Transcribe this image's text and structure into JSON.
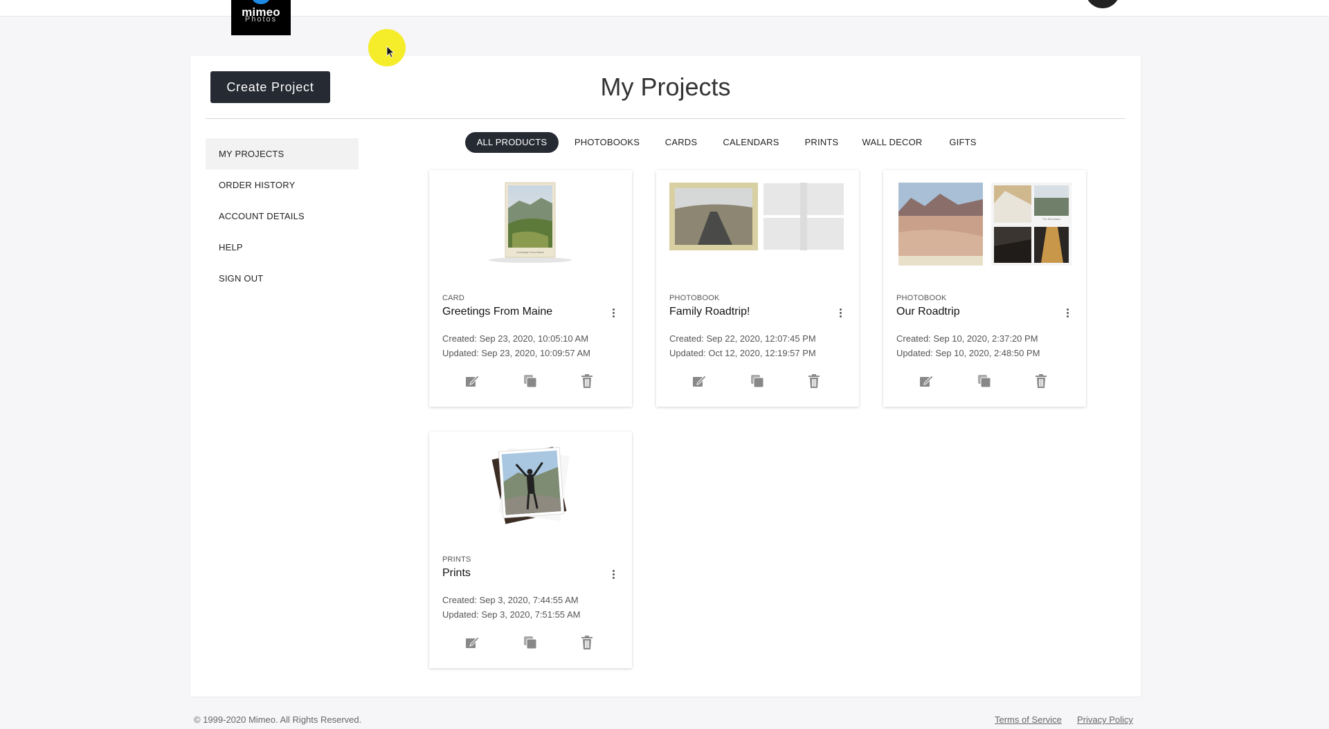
{
  "header": {
    "logo_text": "mimeo",
    "logo_subtext": "Photos"
  },
  "main": {
    "create_button_label": "Create Project",
    "page_title": "My Projects"
  },
  "sidebar": {
    "items": [
      {
        "label": "MY PROJECTS",
        "active": true
      },
      {
        "label": "ORDER HISTORY",
        "active": false
      },
      {
        "label": "ACCOUNT DETAILS",
        "active": false
      },
      {
        "label": "HELP",
        "active": false
      },
      {
        "label": "SIGN OUT",
        "active": false
      }
    ]
  },
  "tabs": [
    {
      "label": "ALL PRODUCTS",
      "active": true
    },
    {
      "label": "PHOTOBOOKS",
      "active": false
    },
    {
      "label": "CARDS",
      "active": false
    },
    {
      "label": "CALENDARS",
      "active": false
    },
    {
      "label": "PRINTS",
      "active": false
    },
    {
      "label": "WALL DECOR",
      "active": false
    },
    {
      "label": "GIFTS",
      "active": false
    }
  ],
  "projects": [
    {
      "type": "CARD",
      "title": "Greetings From Maine",
      "created": "Created: Sep 23, 2020, 10:05:10 AM",
      "updated": "Updated: Sep 23, 2020, 10:09:57 AM",
      "thumb_caption": "Greetings From Maine"
    },
    {
      "type": "PHOTOBOOK",
      "title": "Family Roadtrip!",
      "created": "Created: Sep 22, 2020, 12:07:45 PM",
      "updated": "Updated: Oct 12, 2020, 12:19:57 PM"
    },
    {
      "type": "PHOTOBOOK",
      "title": "Our Roadtrip",
      "created": "Created: Sep 10, 2020, 2:37:20 PM",
      "updated": "Updated: Sep 10, 2020, 2:48:50 PM",
      "thumb_caption": "The Mountains"
    },
    {
      "type": "PRINTS",
      "title": "Prints",
      "created": "Created: Sep 3, 2020, 7:44:55 AM",
      "updated": "Updated: Sep 3, 2020, 7:51:55 AM"
    }
  ],
  "card_actions": {
    "icons": [
      "edit-icon",
      "copy-icon",
      "trash-icon"
    ]
  },
  "footer": {
    "copyright": "© 1999-2020 Mimeo. All Rights Reserved.",
    "terms_label": "Terms of Service",
    "privacy_label": "Privacy Policy"
  },
  "colors": {
    "accent_dark": "#262a33",
    "page_bg": "#f6f6f8",
    "cursor_highlight": "#f5ec2a"
  }
}
